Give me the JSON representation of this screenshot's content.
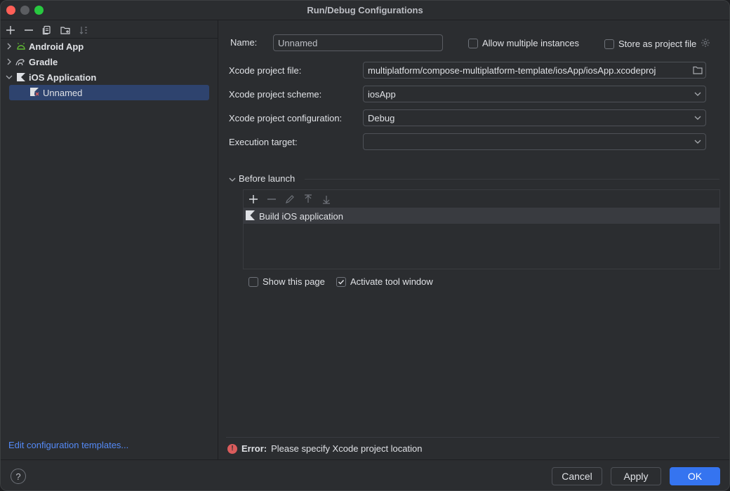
{
  "window": {
    "title": "Run/Debug Configurations"
  },
  "toolbar": {
    "icons": [
      "add-icon",
      "remove-icon",
      "copy-icon",
      "new-folder-icon",
      "sort-icon"
    ]
  },
  "tree": {
    "items": [
      {
        "label": "Android App",
        "icon": "android-icon"
      },
      {
        "label": "Gradle",
        "icon": "gradle-icon"
      },
      {
        "label": "iOS Application",
        "icon": "ios-icon"
      },
      {
        "label": "Unnamed",
        "icon": "ios-config-icon"
      }
    ]
  },
  "edit_templates_link": "Edit configuration templates...",
  "form": {
    "name_label": "Name:",
    "name_value": "Unnamed",
    "allow_multiple": "Allow multiple instances",
    "store_project": "Store as project file",
    "xcode_file_label": "Xcode project file:",
    "xcode_file_value": "multiplatform/compose-multiplatform-template/iosApp/iosApp.xcodeproj",
    "scheme_label": "Xcode project scheme:",
    "scheme_value": "iosApp",
    "config_label": "Xcode project configuration:",
    "config_value": "Debug",
    "target_label": "Execution target:",
    "target_value": ""
  },
  "before_launch": {
    "title": "Before launch",
    "tasks": [
      "Build iOS application"
    ],
    "show_page": "Show this page",
    "activate_tool": "Activate tool window"
  },
  "error": {
    "prefix": "Error:",
    "message": "Please specify Xcode project location"
  },
  "footer": {
    "help": "?",
    "cancel": "Cancel",
    "apply": "Apply",
    "ok": "OK"
  }
}
